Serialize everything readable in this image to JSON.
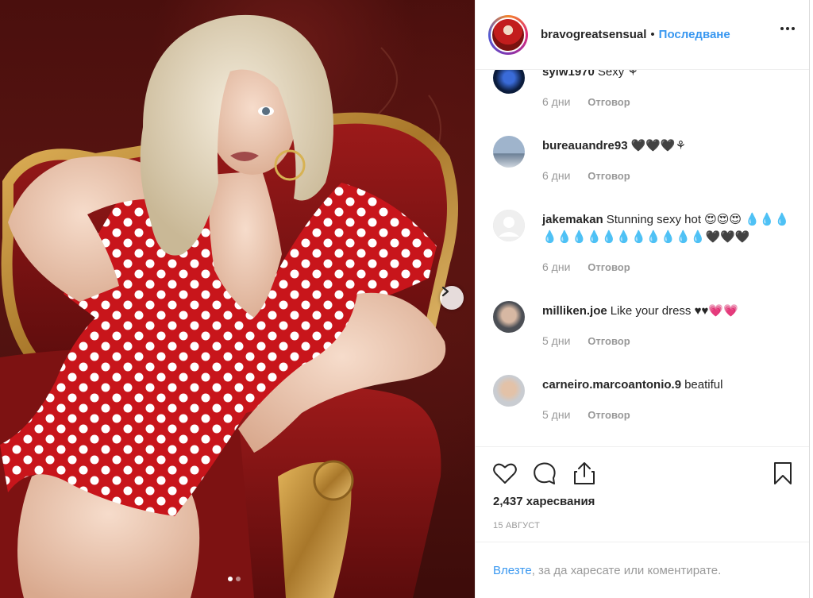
{
  "post": {
    "username": "bravogreatsensual",
    "separator": "•",
    "follow_label": "Последване",
    "more_icon": "more-horizontal-icon",
    "carousel": {
      "current": 1,
      "total": 2,
      "next_icon": "chevron-right-icon"
    }
  },
  "comments": [
    {
      "user": "sylw1970",
      "text": "Sexy ⚘",
      "time": "6 дни",
      "reply": "Отговор"
    },
    {
      "user": "bureauandre93",
      "text": "🖤🖤🖤⚘",
      "time": "6 дни",
      "reply": "Отговор"
    },
    {
      "user": "jakemakan",
      "text": "Stunning sexy hot 😍😍😍 💧💧💧💧💧💧💧💧💧💧💧💧💧💧🖤🖤🖤",
      "time": "6 дни",
      "reply": "Отговор"
    },
    {
      "user": "milliken.joe",
      "text": "Like your dress ♥♥💗💗",
      "time": "5 дни",
      "reply": "Отговор"
    },
    {
      "user": "carneiro.marcoantonio.9",
      "text": "beatiful",
      "time": "5 дни",
      "reply": "Отговор"
    }
  ],
  "actions": {
    "like_icon": "heart-icon",
    "comment_icon": "comment-icon",
    "share_icon": "share-icon",
    "save_icon": "bookmark-icon",
    "likes_text": "2,437 харесвания",
    "date_text": "15 АВГУСТ"
  },
  "login": {
    "link_text": "Влезте",
    "rest_text": ", за да харесате или коментирате."
  },
  "colors": {
    "link": "#3897f0",
    "text": "#262626",
    "muted": "#999999"
  }
}
